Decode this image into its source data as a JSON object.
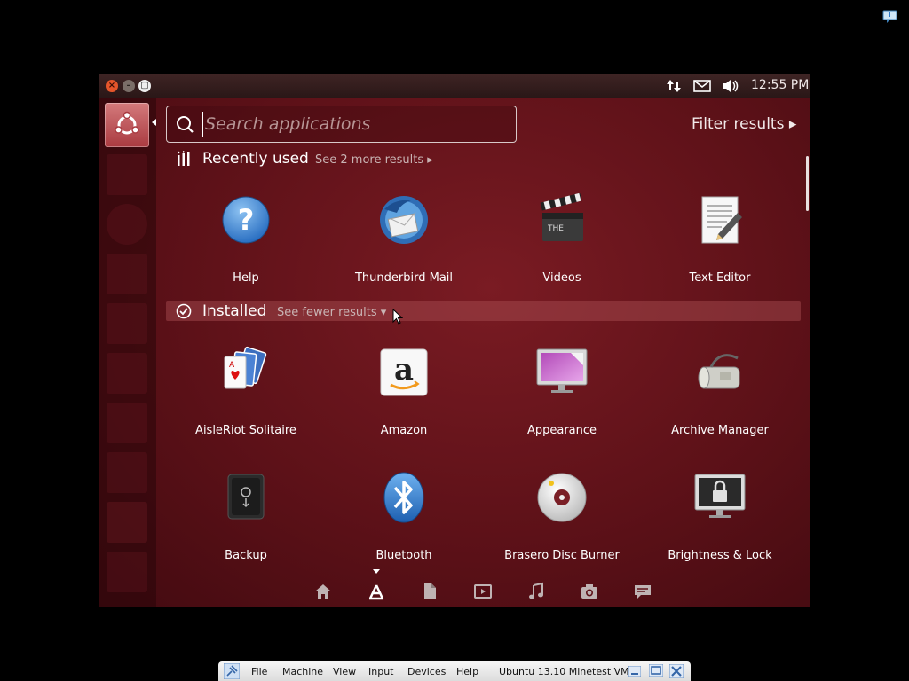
{
  "topbar": {
    "clock": "12:55 PM",
    "icons": [
      "window-close-icon",
      "window-minimize-icon",
      "window-maximize-icon",
      "network-icon",
      "mail-icon",
      "volume-icon"
    ]
  },
  "dash": {
    "search_placeholder": "Search applications",
    "filter_results": "Filter results ▸",
    "categories": [
      {
        "title": "Recently used",
        "more": "See 2 more results ▸",
        "apps": [
          {
            "label": "Help",
            "icon": "help-icon"
          },
          {
            "label": "Thunderbird Mail",
            "icon": "thunderbird-icon"
          },
          {
            "label": "Videos",
            "icon": "clapperboard-icon"
          },
          {
            "label": "Text Editor",
            "icon": "text-editor-icon"
          }
        ]
      },
      {
        "title": "Installed",
        "more": "See fewer results ▾",
        "apps": [
          {
            "label": "AisleRiot Solitaire",
            "icon": "playing-cards-icon"
          },
          {
            "label": "Amazon",
            "icon": "amazon-icon"
          },
          {
            "label": "Appearance",
            "icon": "monitor-appearance-icon"
          },
          {
            "label": "Archive Manager",
            "icon": "archive-manager-icon"
          },
          {
            "label": "Backup",
            "icon": "backup-safe-icon"
          },
          {
            "label": "Bluetooth",
            "icon": "bluetooth-icon"
          },
          {
            "label": "Brasero Disc Burner",
            "icon": "disc-burner-icon"
          },
          {
            "label": "Brightness & Lock",
            "icon": "brightness-lock-icon"
          }
        ]
      }
    ],
    "lenses": [
      "home-lens-icon",
      "applications-lens-icon",
      "files-lens-icon",
      "video-lens-icon",
      "music-lens-icon",
      "photo-lens-icon",
      "social-lens-icon"
    ]
  },
  "vbox": {
    "menus": [
      "File",
      "Machine",
      "View",
      "Input",
      "Devices",
      "Help"
    ],
    "vm_name": "Ubuntu 13.10 Minetest VM"
  },
  "colors": {
    "dash_background": "#5d1118",
    "launcher_bfb": "#c25c60",
    "installed_bar": "#a55056"
  }
}
